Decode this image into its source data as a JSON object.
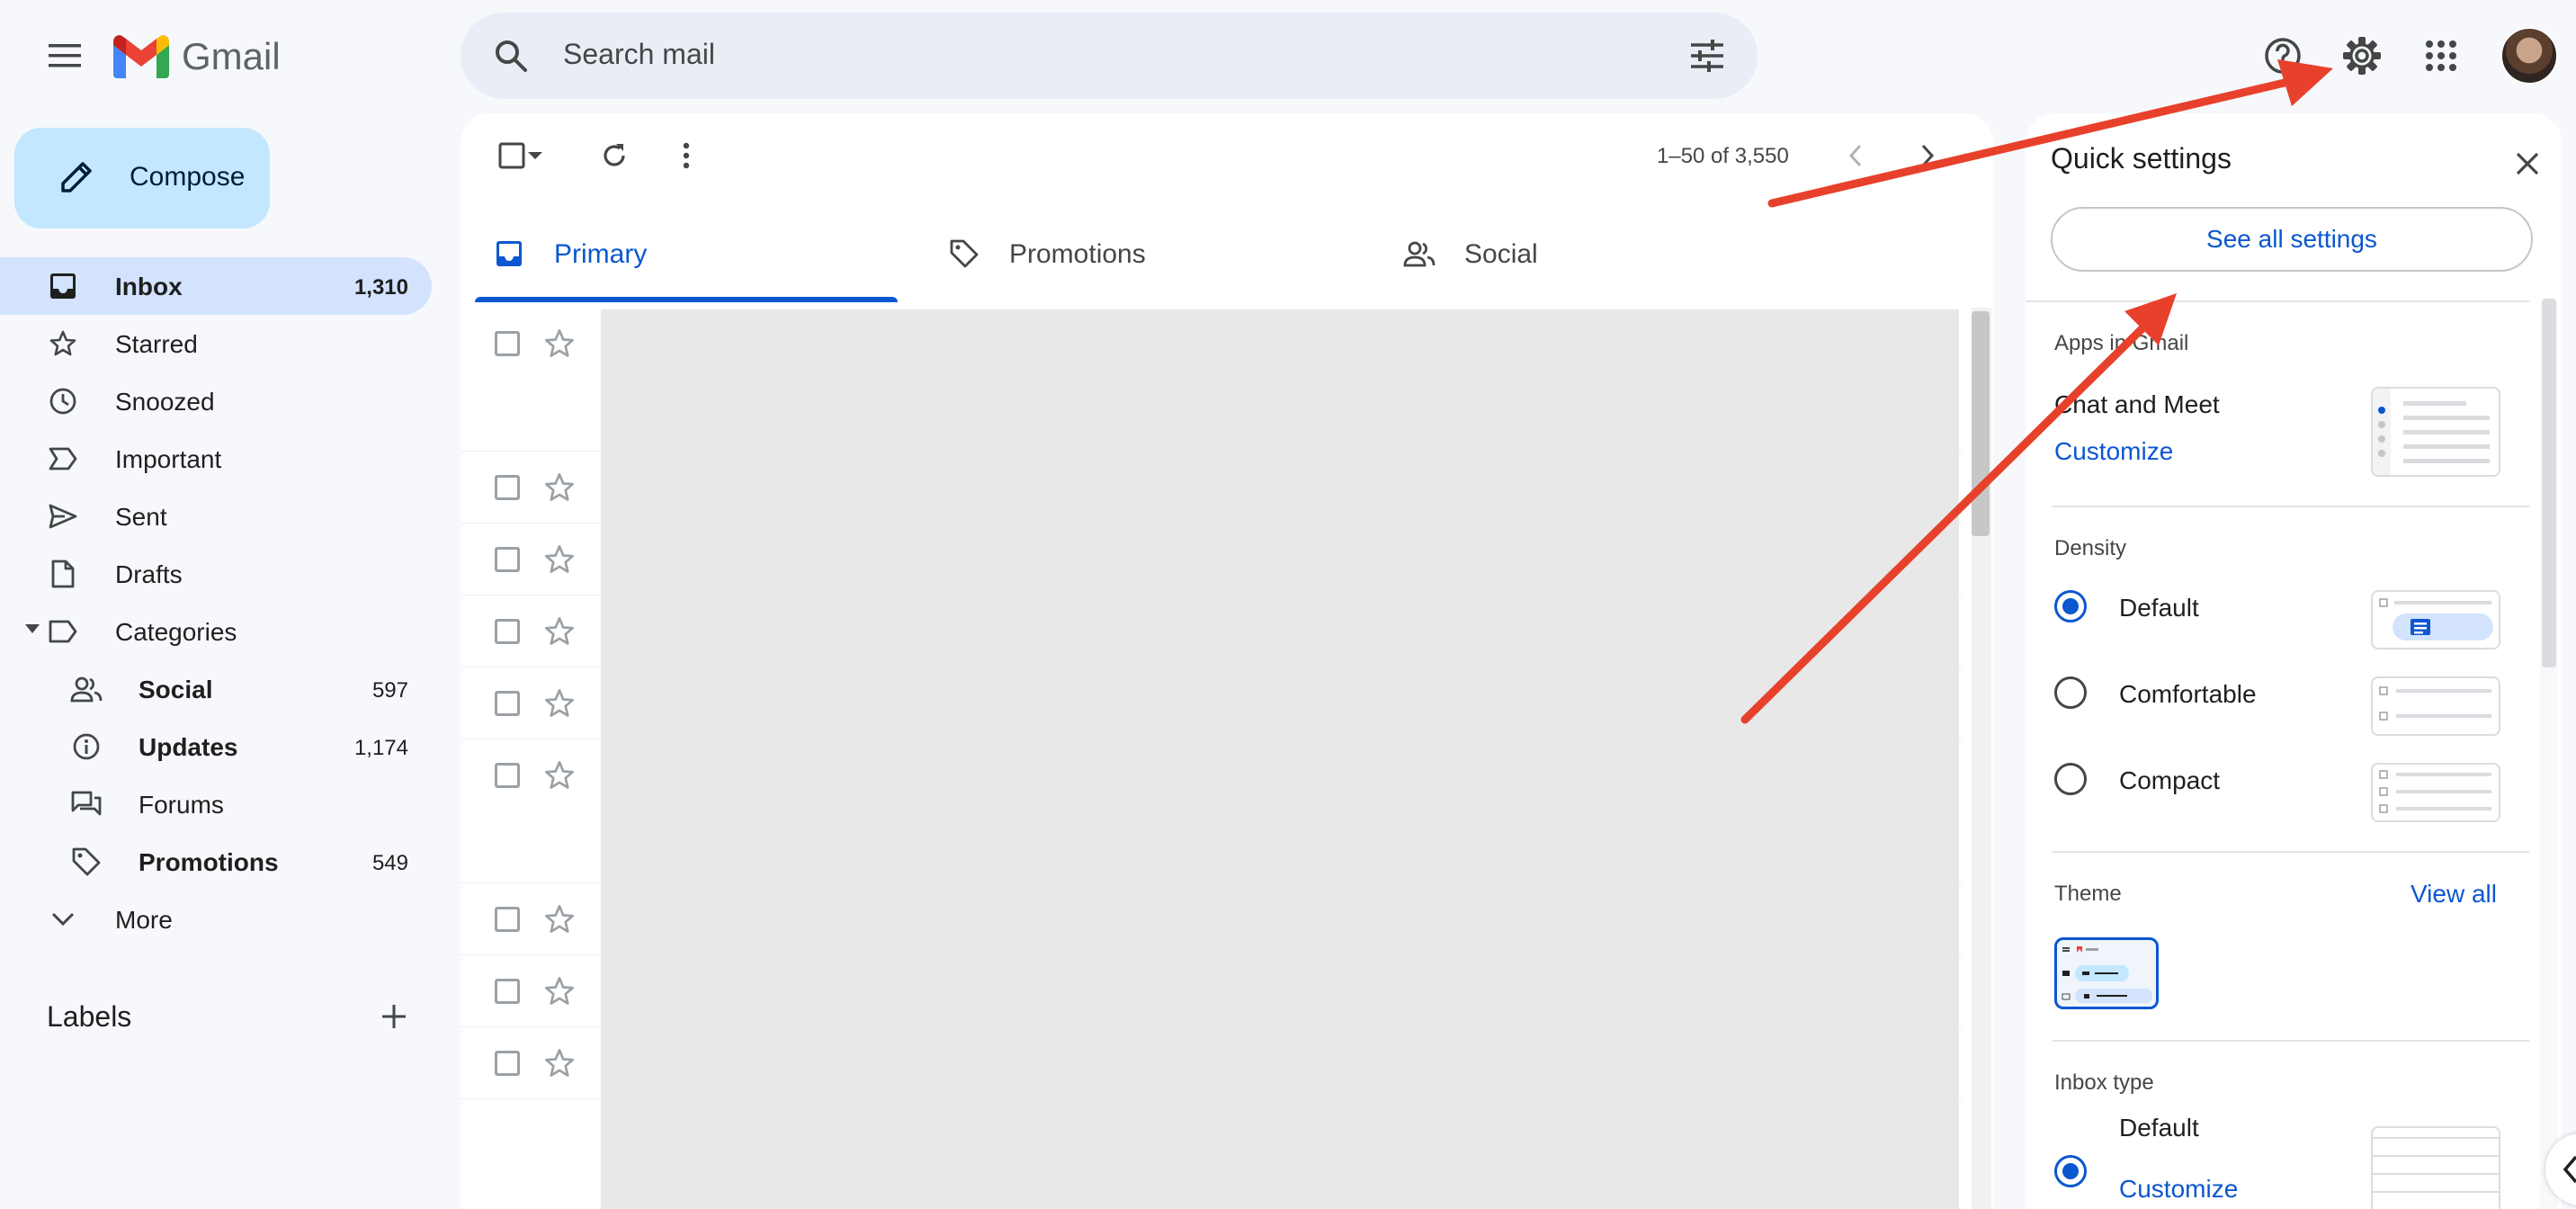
{
  "header": {
    "app_name": "Gmail",
    "search_placeholder": "Search mail"
  },
  "sidebar": {
    "compose_label": "Compose",
    "items": [
      {
        "label": "Inbox",
        "count": "1,310",
        "icon": "inbox-icon",
        "active": true
      },
      {
        "label": "Starred",
        "count": "",
        "icon": "star-icon"
      },
      {
        "label": "Snoozed",
        "count": "",
        "icon": "clock-icon"
      },
      {
        "label": "Important",
        "count": "",
        "icon": "label-important-icon"
      },
      {
        "label": "Sent",
        "count": "",
        "icon": "send-icon"
      },
      {
        "label": "Drafts",
        "count": "",
        "icon": "draft-icon"
      },
      {
        "label": "Categories",
        "count": "",
        "icon": "label-icon"
      },
      {
        "label": "Social",
        "count": "597",
        "icon": "people-icon",
        "bold": true
      },
      {
        "label": "Updates",
        "count": "1,174",
        "icon": "info-icon",
        "bold": true
      },
      {
        "label": "Forums",
        "count": "",
        "icon": "forum-icon"
      },
      {
        "label": "Promotions",
        "count": "549",
        "icon": "tag-icon",
        "bold": true
      },
      {
        "label": "More",
        "count": "",
        "icon": "chevron-down-icon"
      }
    ],
    "labels_title": "Labels"
  },
  "toolbar": {
    "pagination": "1–50 of 3,550"
  },
  "tabs": [
    {
      "label": "Primary",
      "icon": "inbox-icon",
      "active": true
    },
    {
      "label": "Promotions",
      "icon": "tag-icon"
    },
    {
      "label": "Social",
      "icon": "people-icon"
    }
  ],
  "quick_settings": {
    "title": "Quick settings",
    "see_all": "See all settings",
    "apps_title": "Apps in Gmail",
    "apps_item": "Chat and Meet",
    "apps_customize": "Customize",
    "density_title": "Density",
    "density_options": [
      {
        "label": "Default",
        "checked": true
      },
      {
        "label": "Comfortable",
        "checked": false
      },
      {
        "label": "Compact",
        "checked": false
      }
    ],
    "theme_title": "Theme",
    "theme_view_all": "View all",
    "inbox_type_title": "Inbox type",
    "inbox_type_option": "Default",
    "inbox_type_customize": "Customize"
  },
  "colors": {
    "accent": "#0b57d0",
    "annotation_arrow": "#e8412b",
    "compose_bg": "#c2e7ff",
    "active_nav_bg": "#d3e3fd"
  }
}
